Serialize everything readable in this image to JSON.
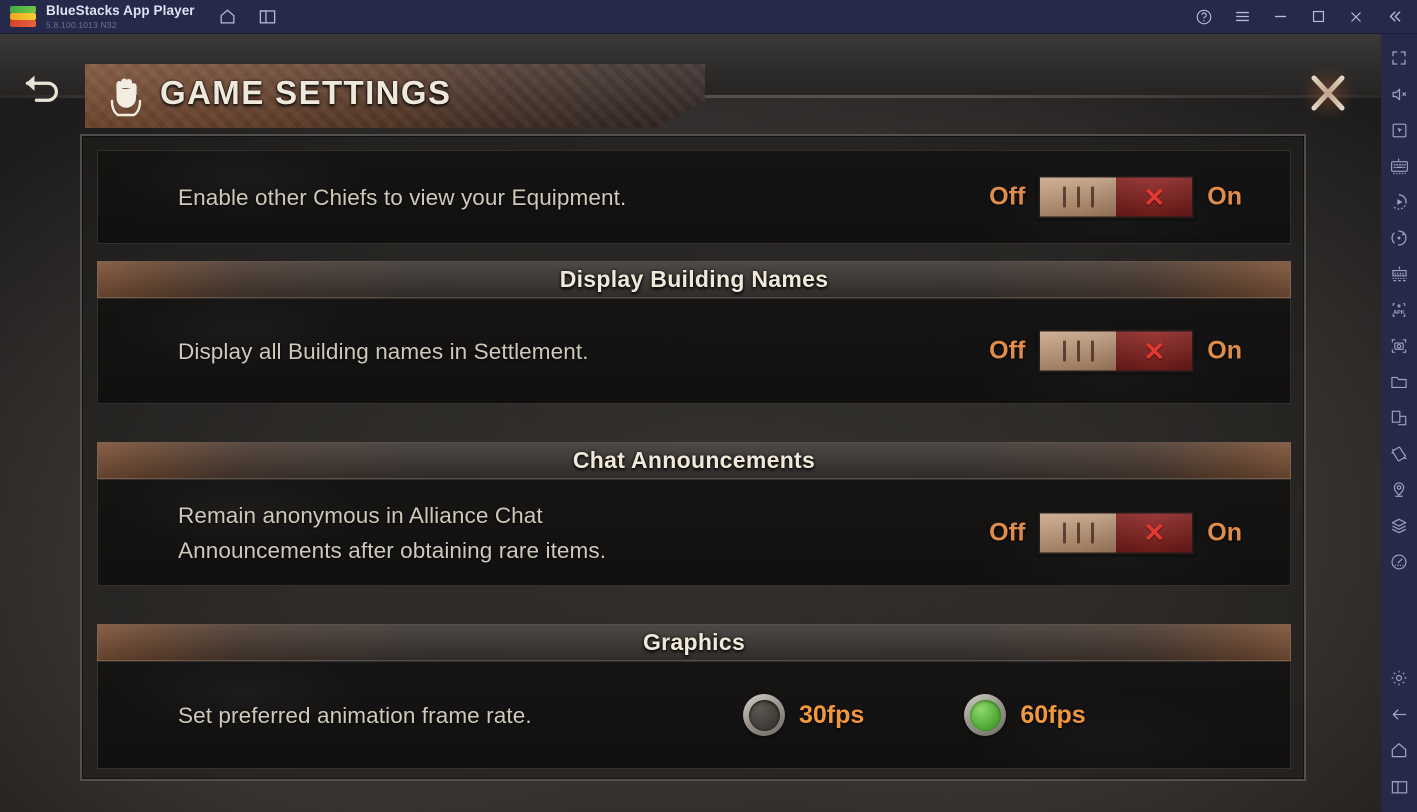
{
  "titlebar": {
    "app_name": "BlueStacks App Player",
    "version": "5.8.100.1013  N32",
    "nav": [
      {
        "name": "home-icon",
        "label": "Home"
      },
      {
        "name": "multi-window-icon",
        "label": "Instances"
      }
    ],
    "controls": [
      {
        "name": "help-icon",
        "label": "Help"
      },
      {
        "name": "hamburger-menu-icon",
        "label": "Menu"
      },
      {
        "name": "minimize-icon",
        "label": "Minimize"
      },
      {
        "name": "maximize-icon",
        "label": "Maximize"
      },
      {
        "name": "close-icon",
        "label": "Close"
      },
      {
        "name": "collapse-chevrons-icon",
        "label": "Collapse"
      }
    ]
  },
  "sidebar": {
    "items": [
      {
        "name": "fullscreen-icon",
        "label": "Full screen"
      },
      {
        "name": "mute-icon",
        "label": "Mute"
      },
      {
        "name": "cursor-pointer-icon",
        "label": "Pointer"
      },
      {
        "name": "keyboard-controls-icon",
        "label": "Game controls"
      },
      {
        "name": "macro-recorder-icon",
        "label": "Macro recorder"
      },
      {
        "name": "rotate-icon",
        "label": "Rotate"
      },
      {
        "name": "multi-instance-sync-icon",
        "label": "Multi-instance sync"
      },
      {
        "name": "install-apk-icon",
        "label": "Install APK"
      },
      {
        "name": "screenshot-icon",
        "label": "Screenshot"
      },
      {
        "name": "media-folder-icon",
        "label": "Media manager"
      },
      {
        "name": "multi-instance-manager-icon",
        "label": "Instance manager"
      },
      {
        "name": "shake-icon",
        "label": "Shake"
      },
      {
        "name": "location-icon",
        "label": "Location"
      },
      {
        "name": "eco-mode-icon",
        "label": "Eco mode"
      },
      {
        "name": "performance-meter-icon",
        "label": "Performance"
      }
    ],
    "bottom_items": [
      {
        "name": "settings-gear-icon",
        "label": "Settings"
      },
      {
        "name": "android-back-icon",
        "label": "Back"
      },
      {
        "name": "android-home-icon",
        "label": "Home"
      },
      {
        "name": "android-recents-icon",
        "label": "Recents"
      }
    ]
  },
  "game_header": {
    "title": "GAME SETTINGS",
    "back_label": "Back",
    "close_label": "Close",
    "emblem": "fist-emblem-icon"
  },
  "settings": {
    "rows": [
      {
        "type": "toggle",
        "section": null,
        "label": "Enable other Chiefs to view your Equipment.",
        "off_label": "Off",
        "on_label": "On",
        "state": "off",
        "mark": "✕"
      },
      {
        "type": "toggle",
        "section": "Display Building Names",
        "label": "Display all Building names in Settlement.",
        "off_label": "Off",
        "on_label": "On",
        "state": "off",
        "mark": "✕"
      },
      {
        "type": "toggle",
        "section": "Chat Announcements",
        "label": "Remain anonymous in Alliance Chat\nAnnouncements after obtaining rare items.",
        "off_label": "Off",
        "on_label": "On",
        "state": "off",
        "mark": "✕"
      },
      {
        "type": "radio",
        "section": "Graphics",
        "label": "Set preferred animation frame rate.",
        "options": [
          {
            "label": "30fps",
            "selected": false
          },
          {
            "label": "60fps",
            "selected": true
          }
        ]
      }
    ]
  },
  "colors": {
    "accent_orange": "#e08c4a",
    "radio_orange": "#f0973f",
    "toggle_red": "#8e2422",
    "toggle_x": "#e4392f",
    "knob_tan": "#bb9270",
    "selected_green": "#57b03a",
    "header_brown": "#7c5238",
    "bluestacks_navy": "#262949"
  }
}
